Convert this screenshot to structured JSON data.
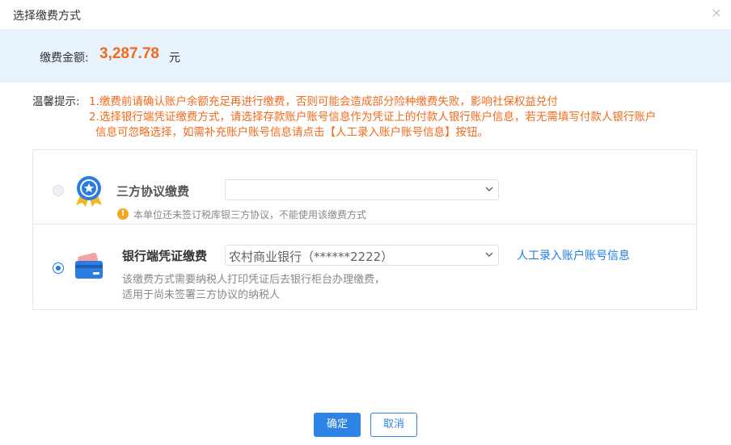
{
  "dialog": {
    "title": "选择缴费方式"
  },
  "amount": {
    "label": "缴费金额:",
    "value": "3,287.78",
    "unit": "元"
  },
  "tips": {
    "label": "温馨提示:",
    "line1": "1.缴费前请确认账户余额充足再进行缴费，否则可能会造成部分险种缴费失败，影响社保权益兑付",
    "line2": "2.选择银行端凭证缴费方式，请选择存款账户账号信息作为凭证上的付款人银行账户信息，若无需填写付款人银行账户",
    "line3": "信息可忽略选择，如需补充账户账号信息请点击【人工录入账户账号信息】按钮。"
  },
  "options": {
    "third_party": {
      "name": "三方协议缴费",
      "selected": false,
      "disabled": true,
      "select_value": "",
      "warning": "本单位还未签订税库银三方协议，不能使用该缴费方式",
      "icon": "award-badge-icon"
    },
    "bank_voucher": {
      "name": "银行端凭证缴费",
      "selected": true,
      "select_value": "农村商业银行（******2222）",
      "link": "人工录入账户账号信息",
      "desc_line1": "该缴费方式需要纳税人打印凭证后去银行柜台办理缴费，",
      "desc_line2": "适用于尚未签署三方协议的纳税人",
      "icon": "bank-card-icon"
    }
  },
  "buttons": {
    "ok": "确定",
    "cancel": "取消"
  },
  "colors": {
    "accent": "#1e7ce6",
    "amount": "#f26a1b",
    "tip": "#f26a1b",
    "header_bg": "#e8f2fd"
  }
}
